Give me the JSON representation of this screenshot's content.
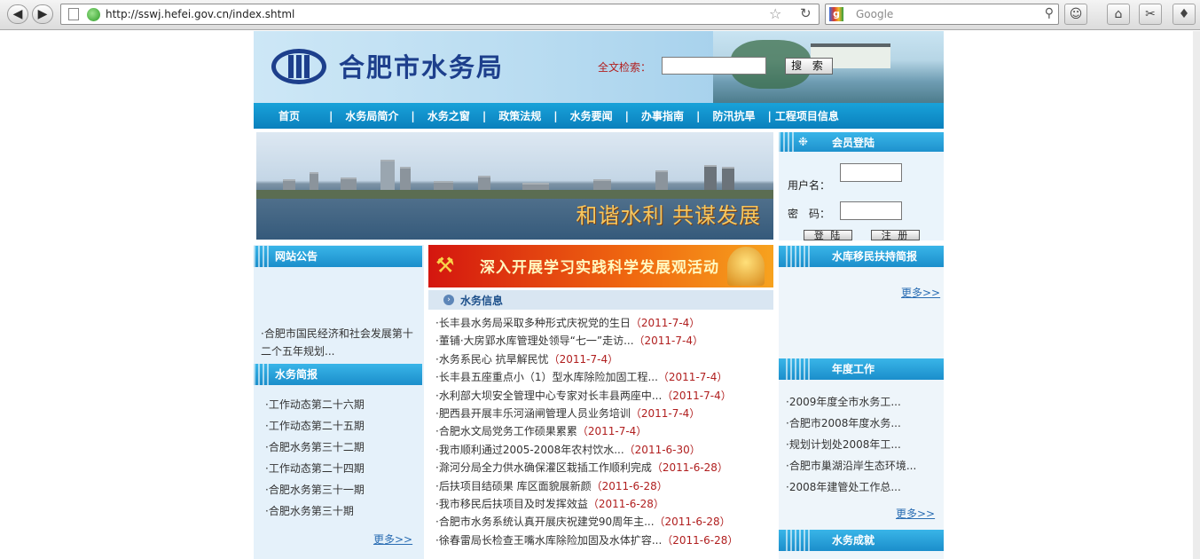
{
  "browser": {
    "url": "http://sswj.hefei.gov.cn/index.shtml",
    "search_placeholder": "Google"
  },
  "site": {
    "title": "合肥市水务局",
    "search_label": "全文检索：",
    "search_button": "搜 索"
  },
  "nav": {
    "items": [
      "首页",
      "水务局简介",
      "水务之窗",
      "政策法规",
      "水务要闻",
      "办事指南",
      "防汛抗旱",
      "工程项目信息"
    ]
  },
  "banner": {
    "slogan": "和谐水利   共谋发展"
  },
  "login": {
    "title": "会员登陆",
    "username_label": "用户名：",
    "password_label": "密　码：",
    "login_button": "登 陆",
    "register_button": "注 册"
  },
  "notice": {
    "title": "网站公告",
    "text": "·合肥市国民经济和社会发展第十二个五年规划..."
  },
  "brief": {
    "title": "水务简报",
    "items": [
      "·工作动态第二十六期",
      "·工作动态第二十五期",
      "·合肥水务第三十二期",
      "·工作动态第二十四期",
      "·合肥水务第三十一期",
      "·合肥水务第三十期"
    ],
    "more": "更多>>"
  },
  "promo": {
    "text": "深入开展学习实践科学发展观活动"
  },
  "news": {
    "title": "水务信息",
    "items": [
      {
        "text": "·长丰县水务局采取多种形式庆祝党的生日",
        "date": "（2011-7-4）"
      },
      {
        "text": "·董铺·大房郢水库管理处领导“七一”走访...",
        "date": "（2011-7-4）"
      },
      {
        "text": "·水务系民心 抗旱解民忧",
        "date": "（2011-7-4）"
      },
      {
        "text": "·长丰县五座重点小（1）型水库除险加固工程...",
        "date": "（2011-7-4）"
      },
      {
        "text": "·水利部大坝安全管理中心专家对长丰县两座中...",
        "date": "（2011-7-4）"
      },
      {
        "text": "·肥西县开展丰乐河涵闸管理人员业务培训",
        "date": "（2011-7-4）"
      },
      {
        "text": "·合肥水文局党务工作硕果累累",
        "date": "（2011-7-4）"
      },
      {
        "text": "·我市顺利通过2005-2008年农村饮水...",
        "date": "（2011-6-30）"
      },
      {
        "text": "·滁河分局全力供水确保灌区栽插工作顺利完成",
        "date": "（2011-6-28）"
      },
      {
        "text": "·后扶项目结硕果 库区面貌展新颜",
        "date": "（2011-6-28）"
      },
      {
        "text": "·我市移民后扶项目及时发挥效益",
        "date": "（2011-6-28）"
      },
      {
        "text": "·合肥市水务系统认真开展庆祝建党90周年主...",
        "date": "（2011-6-28）"
      },
      {
        "text": "·徐春雷局长检查王嘴水库除险加固及水体扩容...",
        "date": "（2011-6-28）"
      }
    ]
  },
  "resettlement": {
    "title": "水库移民扶持简报",
    "more": "更多>>"
  },
  "annual": {
    "title": "年度工作",
    "items": [
      "·2009年度全市水务工...",
      "·合肥市2008年度水务...",
      "·规划计划处2008年工...",
      "·合肥市巢湖沿岸生态环境...",
      "·2008年建管处工作总..."
    ],
    "more": "更多>>"
  },
  "achievements": {
    "title": "水务成就"
  }
}
